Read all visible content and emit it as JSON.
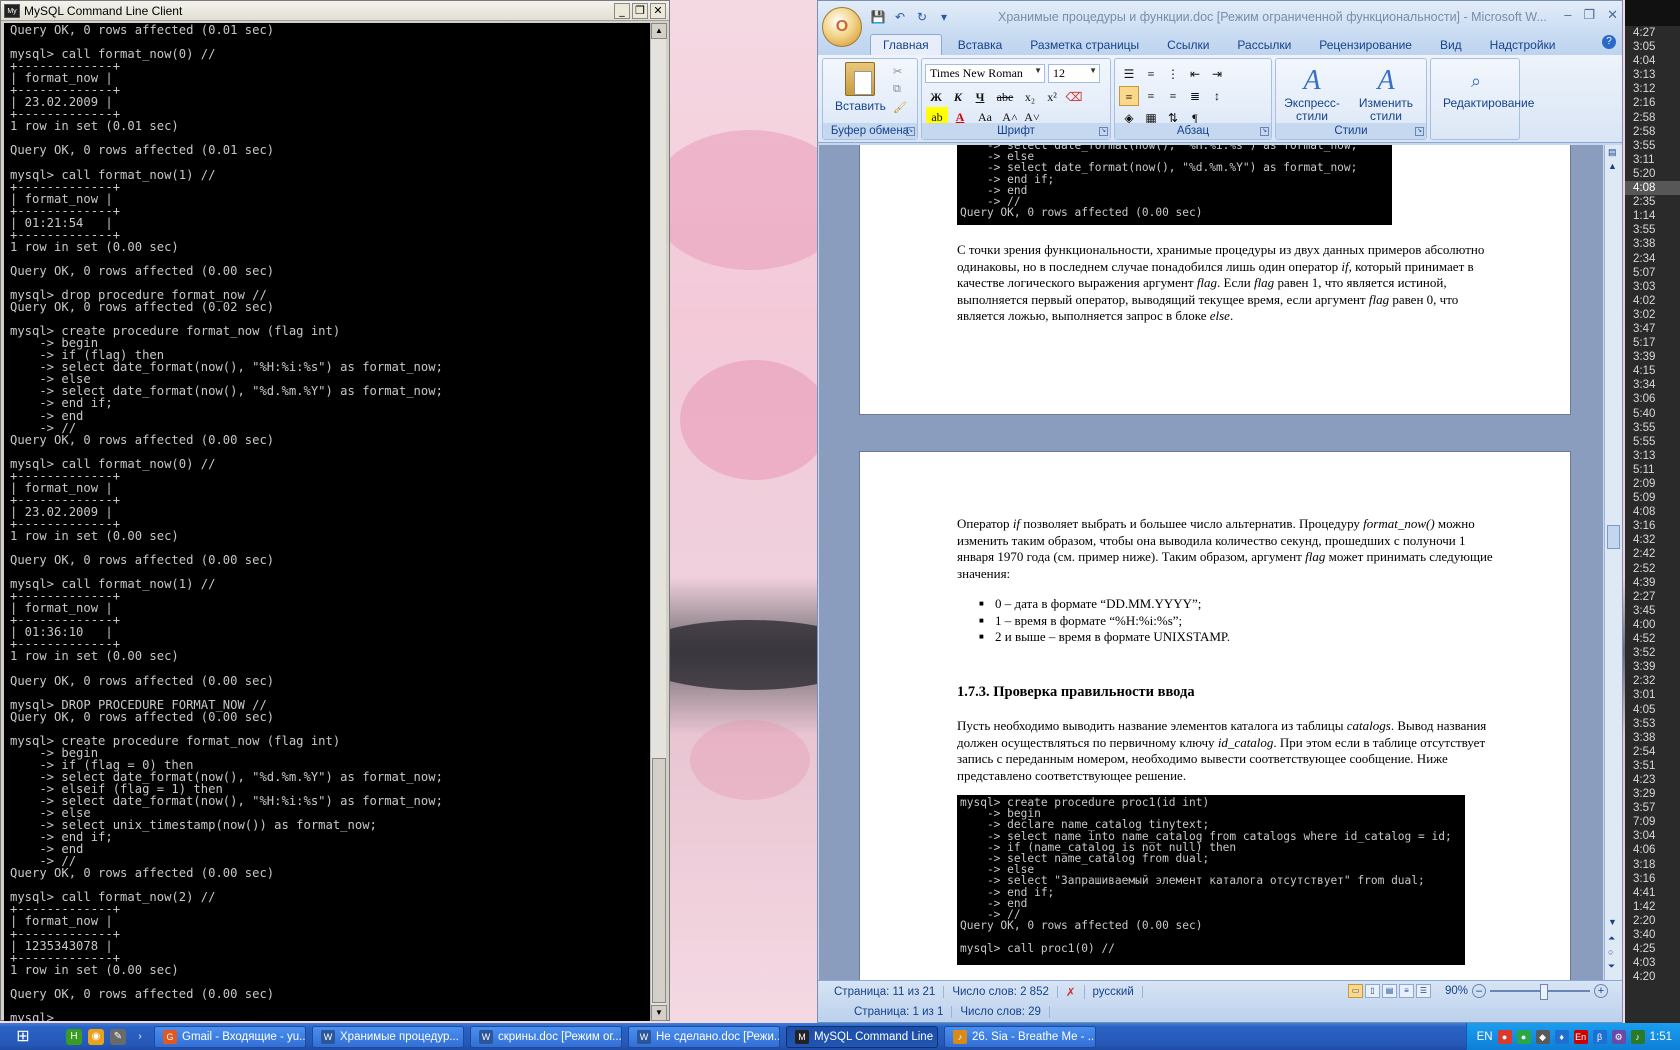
{
  "console": {
    "title": "MySQL Command Line Client",
    "lines": [
      "Query OK, 0 rows affected (0.01 sec)",
      "",
      "mysql> call format_now(0) //",
      "+-------------+",
      "| format_now |",
      "+-------------+",
      "| 23.02.2009 |",
      "+-------------+",
      "1 row in set (0.01 sec)",
      "",
      "Query OK, 0 rows affected (0.01 sec)",
      "",
      "mysql> call format_now(1) //",
      "+-------------+",
      "| format_now |",
      "+-------------+",
      "| 01:21:54   |",
      "+-------------+",
      "1 row in set (0.00 sec)",
      "",
      "Query OK, 0 rows affected (0.00 sec)",
      "",
      "mysql> drop procedure format_now //",
      "Query OK, 0 rows affected (0.02 sec)",
      "",
      "mysql> create procedure format_now (flag int)",
      "    -> begin",
      "    -> if (flag) then",
      "    -> select date_format(now(), \"%H:%i:%s\") as format_now;",
      "    -> else",
      "    -> select date_format(now(), \"%d.%m.%Y\") as format_now;",
      "    -> end if;",
      "    -> end",
      "    -> //",
      "Query OK, 0 rows affected (0.00 sec)",
      "",
      "mysql> call format_now(0) //",
      "+-------------+",
      "| format_now |",
      "+-------------+",
      "| 23.02.2009 |",
      "+-------------+",
      "1 row in set (0.00 sec)",
      "",
      "Query OK, 0 rows affected (0.00 sec)",
      "",
      "mysql> call format_now(1) //",
      "+-------------+",
      "| format_now |",
      "+-------------+",
      "| 01:36:10   |",
      "+-------------+",
      "1 row in set (0.00 sec)",
      "",
      "Query OK, 0 rows affected (0.00 sec)",
      "",
      "mysql> DROP PROCEDURE FORMAT_NOW //",
      "Query OK, 0 rows affected (0.00 sec)",
      "",
      "mysql> create procedure format_now (flag int)",
      "    -> begin",
      "    -> if (flag = 0) then",
      "    -> select date_format(now(), \"%d.%m.%Y\") as format_now;",
      "    -> elseif (flag = 1) then",
      "    -> select date_format(now(), \"%H:%i:%s\") as format_now;",
      "    -> else",
      "    -> select unix_timestamp(now()) as format_now;",
      "    -> end if;",
      "    -> end",
      "    -> //",
      "Query OK, 0 rows affected (0.00 sec)",
      "",
      "mysql> call format_now(2) //",
      "+-------------+",
      "| format_now |",
      "+-------------+",
      "| 1235343078 |",
      "+-------------+",
      "1 row in set (0.00 sec)",
      "",
      "Query OK, 0 rows affected (0.00 sec)",
      "",
      "mysql> _"
    ]
  },
  "word": {
    "title": "Хранимые процедуры и функции.doc [Режим ограниченной функциональности] - Microsoft W...",
    "office_button": "O",
    "tabs": [
      "Главная",
      "Вставка",
      "Разметка страницы",
      "Ссылки",
      "Рассылки",
      "Рецензирование",
      "Вид",
      "Надстройки"
    ],
    "help": "?",
    "ribbon": {
      "clipboard_label": "Буфер обмена",
      "paste_label": "Вставить",
      "font_label": "Шрифт",
      "font_name": "Times New Roman",
      "font_size": "12",
      "bold": "Ж",
      "italic": "К",
      "underline": "Ч",
      "strike": "abe",
      "subscript": "x₂",
      "superscript": "x²",
      "grow": "A˄",
      "shrink": "A˅",
      "case": "Aa",
      "paragraph_label": "Абзац",
      "styles_label": "Стили",
      "quick_styles": "Экспресс-стили",
      "change_styles": "Изменить стили",
      "editing_label": "Редактирование"
    },
    "page1": {
      "cmd_lines": [
        "    -> select date_format(now(), \"%H:%i:%s\") as format_now;",
        "    -> else",
        "    -> select date_format(now(), \"%d.%m.%Y\") as format_now;",
        "    -> end if;",
        "    -> end",
        "    -> //",
        "Query OK, 0 rows affected (0.00 sec)"
      ],
      "para_1": "С точки зрения функциональности, хранимые процедуры из двух данных примеров абсолютно одинаковы, но в последнем случае понадобился лишь один оператор ",
      "para_1_if": "if,",
      "para_1b": " который принимает в качестве логического выражения аргумент ",
      "para_1_flag": "flag",
      "para_1c": ". Если ",
      "para_1_flag2": "flag",
      "para_1d": " равен 1, что является истиной, выполняется первый оператор, выводящий текущее время, если аргумент ",
      "para_1_flag3": "flag",
      "para_1e": " равен 0, что является ложью, выполняется запрос в блоке ",
      "para_1_else": "else",
      "para_1f": "."
    },
    "page2": {
      "para_a1": "Оператор ",
      "para_a_if": "if",
      "para_a2": " позволяет выбрать и большее число альтернатив. Процедуру ",
      "para_a_fn": "format_now()",
      "para_a3": " можно изменить таким образом, чтобы она выводила количество секунд, прошедших с полуночи 1 января 1970 года (см. пример ниже). Таким образом, аргумент ",
      "para_a_flag": "flag",
      "para_a4": " может принимать следующие значения:",
      "bullets": [
        "0 – дата в формате “DD.MM.YYYY”;",
        "1 – время в формате  “%H:%i:%s”;",
        "2 и выше – время в формате UNIXSTAMP."
      ],
      "heading": "1.7.3. Проверка правильности ввода",
      "para_b1": "Пусть необходимо выводить название элементов каталога из таблицы ",
      "para_b_cat": "catalogs",
      "para_b2": ". Вывод названия должен осуществляться по первичному ключу ",
      "para_b_id": "id_catalog",
      "para_b3": ". При этом если в таблице отсутствует запись с переданным номером, необходимо вывести соответствующее сообщение. Ниже представлено соответствующее решение.",
      "cmd_lines": [
        "mysql> create procedure proc1(id int)",
        "    -> begin",
        "    -> declare name_catalog tinytext;",
        "    -> select name into name_catalog from catalogs where id_catalog = id;",
        "    -> if (name_catalog is not null) then",
        "    -> select name_catalog from dual;",
        "    -> else",
        "    -> select \"Запрашиваемый элемент каталога отсутствует\" from dual;",
        "    -> end if;",
        "    -> end",
        "    -> //",
        "Query OK, 0 rows affected (0.00 sec)",
        "",
        "mysql> call proc1(0) //"
      ]
    },
    "status": {
      "page": "Страница: 11 из 21",
      "words": "Число слов: 2 852",
      "lang": "русский",
      "zoom": "90%",
      "section": "Страница: 1 из 1",
      "words2": "Число слов: 29"
    }
  },
  "time_strip": [
    "4:27",
    "3:05",
    "4:04",
    "3:13",
    "3:12",
    "2:16",
    "2:58",
    "2:58",
    "3:55",
    "3:11",
    "5:20",
    "4:08",
    "2:35",
    "1:14",
    "3:55",
    "3:38",
    "2:34",
    "5:07",
    "3:03",
    "4:02",
    "3:02",
    "3:47",
    "5:17",
    "3:39",
    "4:15",
    "3:34",
    "3:06",
    "5:40",
    "3:55",
    "5:55",
    "3:13",
    "5:11",
    "2:09",
    "5:09",
    "4:08",
    "3:16",
    "4:32",
    "2:42",
    "2:52",
    "4:39",
    "2:27",
    "3:45",
    "4:00",
    "4:52",
    "3:52",
    "3:39",
    "2:32",
    "3:01",
    "4:05",
    "3:53",
    "3:38",
    "2:54",
    "3:51",
    "4:23",
    "3:29",
    "3:57",
    "7:09",
    "3:04",
    "4:06",
    "3:18",
    "3:16",
    "4:41",
    "1:42",
    "2:20",
    "3:40",
    "4:25",
    "4:03",
    "4:20"
  ],
  "time_selected_index": 11,
  "taskbar": {
    "tasks": [
      {
        "label": "Gmail - Входящие - yu...",
        "icon": "G",
        "color": "#e25822",
        "active": false
      },
      {
        "label": "Хранимые процедур...",
        "icon": "W",
        "color": "#2b579a",
        "active": false
      },
      {
        "label": "скрины.doc [Режим ог...",
        "icon": "W",
        "color": "#2b579a",
        "active": false
      },
      {
        "label": "Не сделано.doc [Режи...",
        "icon": "W",
        "color": "#2b579a",
        "active": false
      },
      {
        "label": "MySQL Command Line ...",
        "icon": "M",
        "color": "#222222",
        "active": true
      },
      {
        "label": "26. Sia - Breathe Me - ...",
        "icon": "♪",
        "color": "#d88a1a",
        "active": false
      }
    ],
    "lang": "EN",
    "lang2": "En",
    "clock": "1:51"
  }
}
